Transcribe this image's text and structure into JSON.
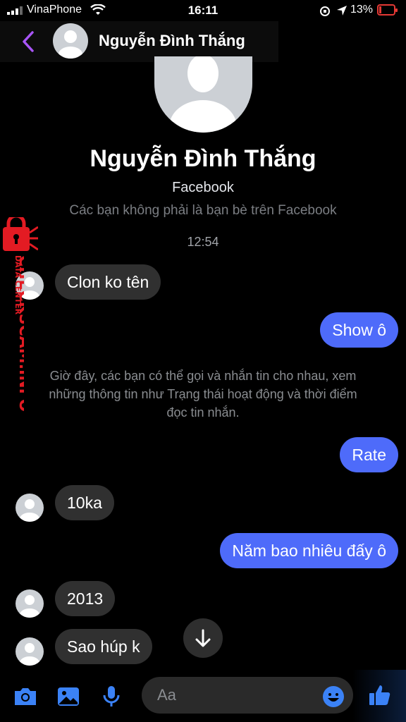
{
  "status": {
    "carrier": "VinaPhone",
    "time": "16:11",
    "battery_percent": "13%"
  },
  "header": {
    "name": "Nguyễn Đình Thắng"
  },
  "profile": {
    "name": "Nguyễn Đình Thắng",
    "subtitle": "Facebook",
    "note": "Các bạn không phải là bạn bè trên Facebook"
  },
  "conversation": {
    "timestamp": "12:54",
    "system_message_lines": [
      "Giờ đây, các bạn có thể gọi và nhắn tin cho nhau, xem",
      "những thông tin như Trạng thái hoạt động và thời điểm",
      "đọc tin nhắn."
    ],
    "messages": [
      {
        "from": "them",
        "text": "Clon ko tên"
      },
      {
        "from": "me",
        "text": "Show ô"
      },
      {
        "from": "me",
        "text": "Rate"
      },
      {
        "from": "them",
        "text": "10ka"
      },
      {
        "from": "me",
        "text": "Năm bao nhiêu đấy ô"
      },
      {
        "from": "them",
        "text": "2013"
      },
      {
        "from": "them",
        "text": "Sao húp k"
      }
    ]
  },
  "watermark": {
    "line1": "DATA CENTER",
    "line2": "CHECKSCAM.INFO"
  },
  "composer": {
    "placeholder": "Aa"
  },
  "colors": {
    "accent": "#4e6bfa",
    "back_arrow": "#a855f7",
    "incoming_bubble": "#303030",
    "composer_icons": "#3b82f6"
  },
  "icons": [
    "signal-icon",
    "wifi-icon",
    "location-icon",
    "battery-icon",
    "back-icon",
    "camera-icon",
    "photo-icon",
    "microphone-icon",
    "emoji-icon",
    "like-icon",
    "arrow-down-icon"
  ]
}
